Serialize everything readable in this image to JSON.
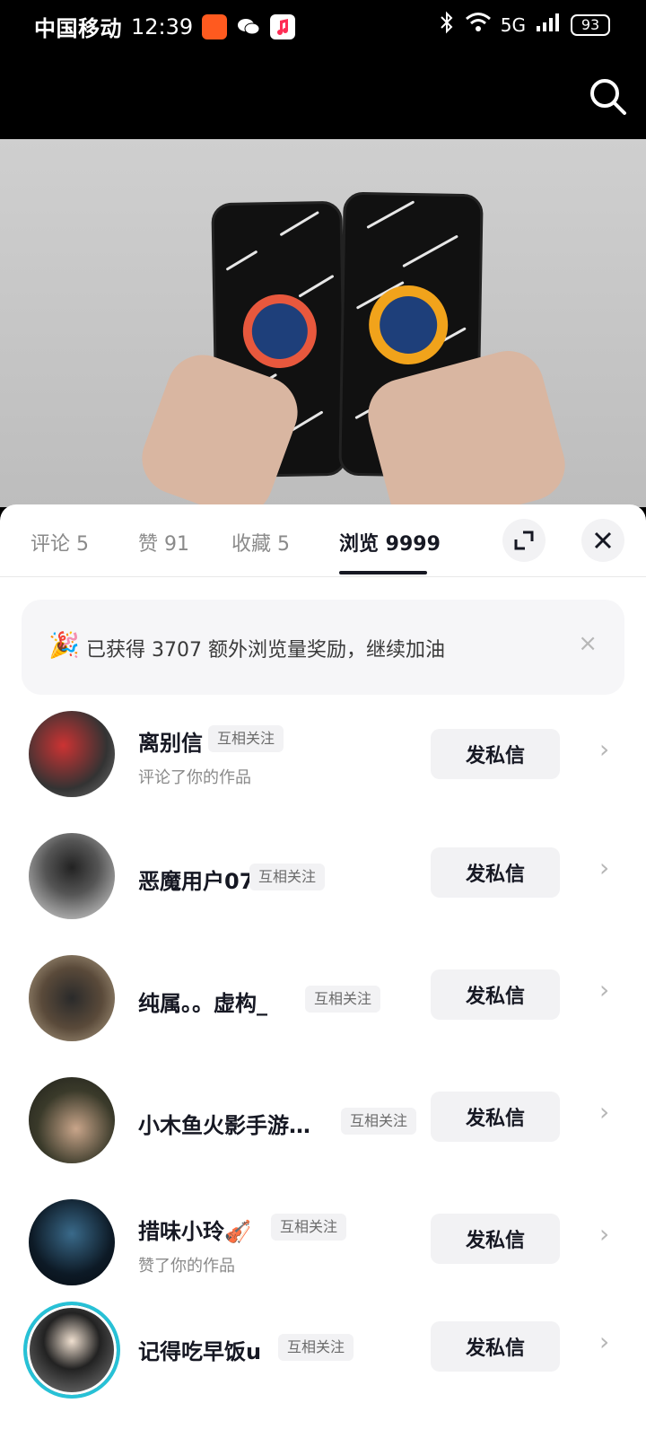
{
  "status_bar": {
    "carrier": "中国移动",
    "time": "12:39",
    "network": "5G",
    "battery": "93"
  },
  "tabs": [
    {
      "label": "评论 5"
    },
    {
      "label": "赞 91"
    },
    {
      "label": "收藏 5"
    },
    {
      "label": "浏览 9999"
    }
  ],
  "active_tab": "浏览 9999",
  "notice": {
    "emoji": "🎉",
    "text": "已获得 3707 额外浏览量奖励，继续加油",
    "close": "×"
  },
  "users": [
    {
      "name": "离别信",
      "tag": "互相关注",
      "sub": "评论了你的作品",
      "button": "发私信",
      "chevron": "›"
    },
    {
      "name": "恶魔用户07",
      "tag": "互相关注",
      "sub": "",
      "button": "发私信",
      "chevron": "›"
    },
    {
      "name": "纯属。。虚构_",
      "tag": "互相关注",
      "sub": "",
      "button": "发私信",
      "chevron": "›"
    },
    {
      "name": "小木鱼火影手游…",
      "tag": "互相关注",
      "sub": "",
      "button": "发私信",
      "chevron": "›"
    },
    {
      "name": "措味小玲🎻",
      "tag": "互相关注",
      "sub": "赞了你的作品",
      "button": "发私信",
      "chevron": "›"
    },
    {
      "name": "记得吃早饭u",
      "tag": "互相关注",
      "sub": "",
      "button": "发私信",
      "chevron": "›"
    }
  ]
}
